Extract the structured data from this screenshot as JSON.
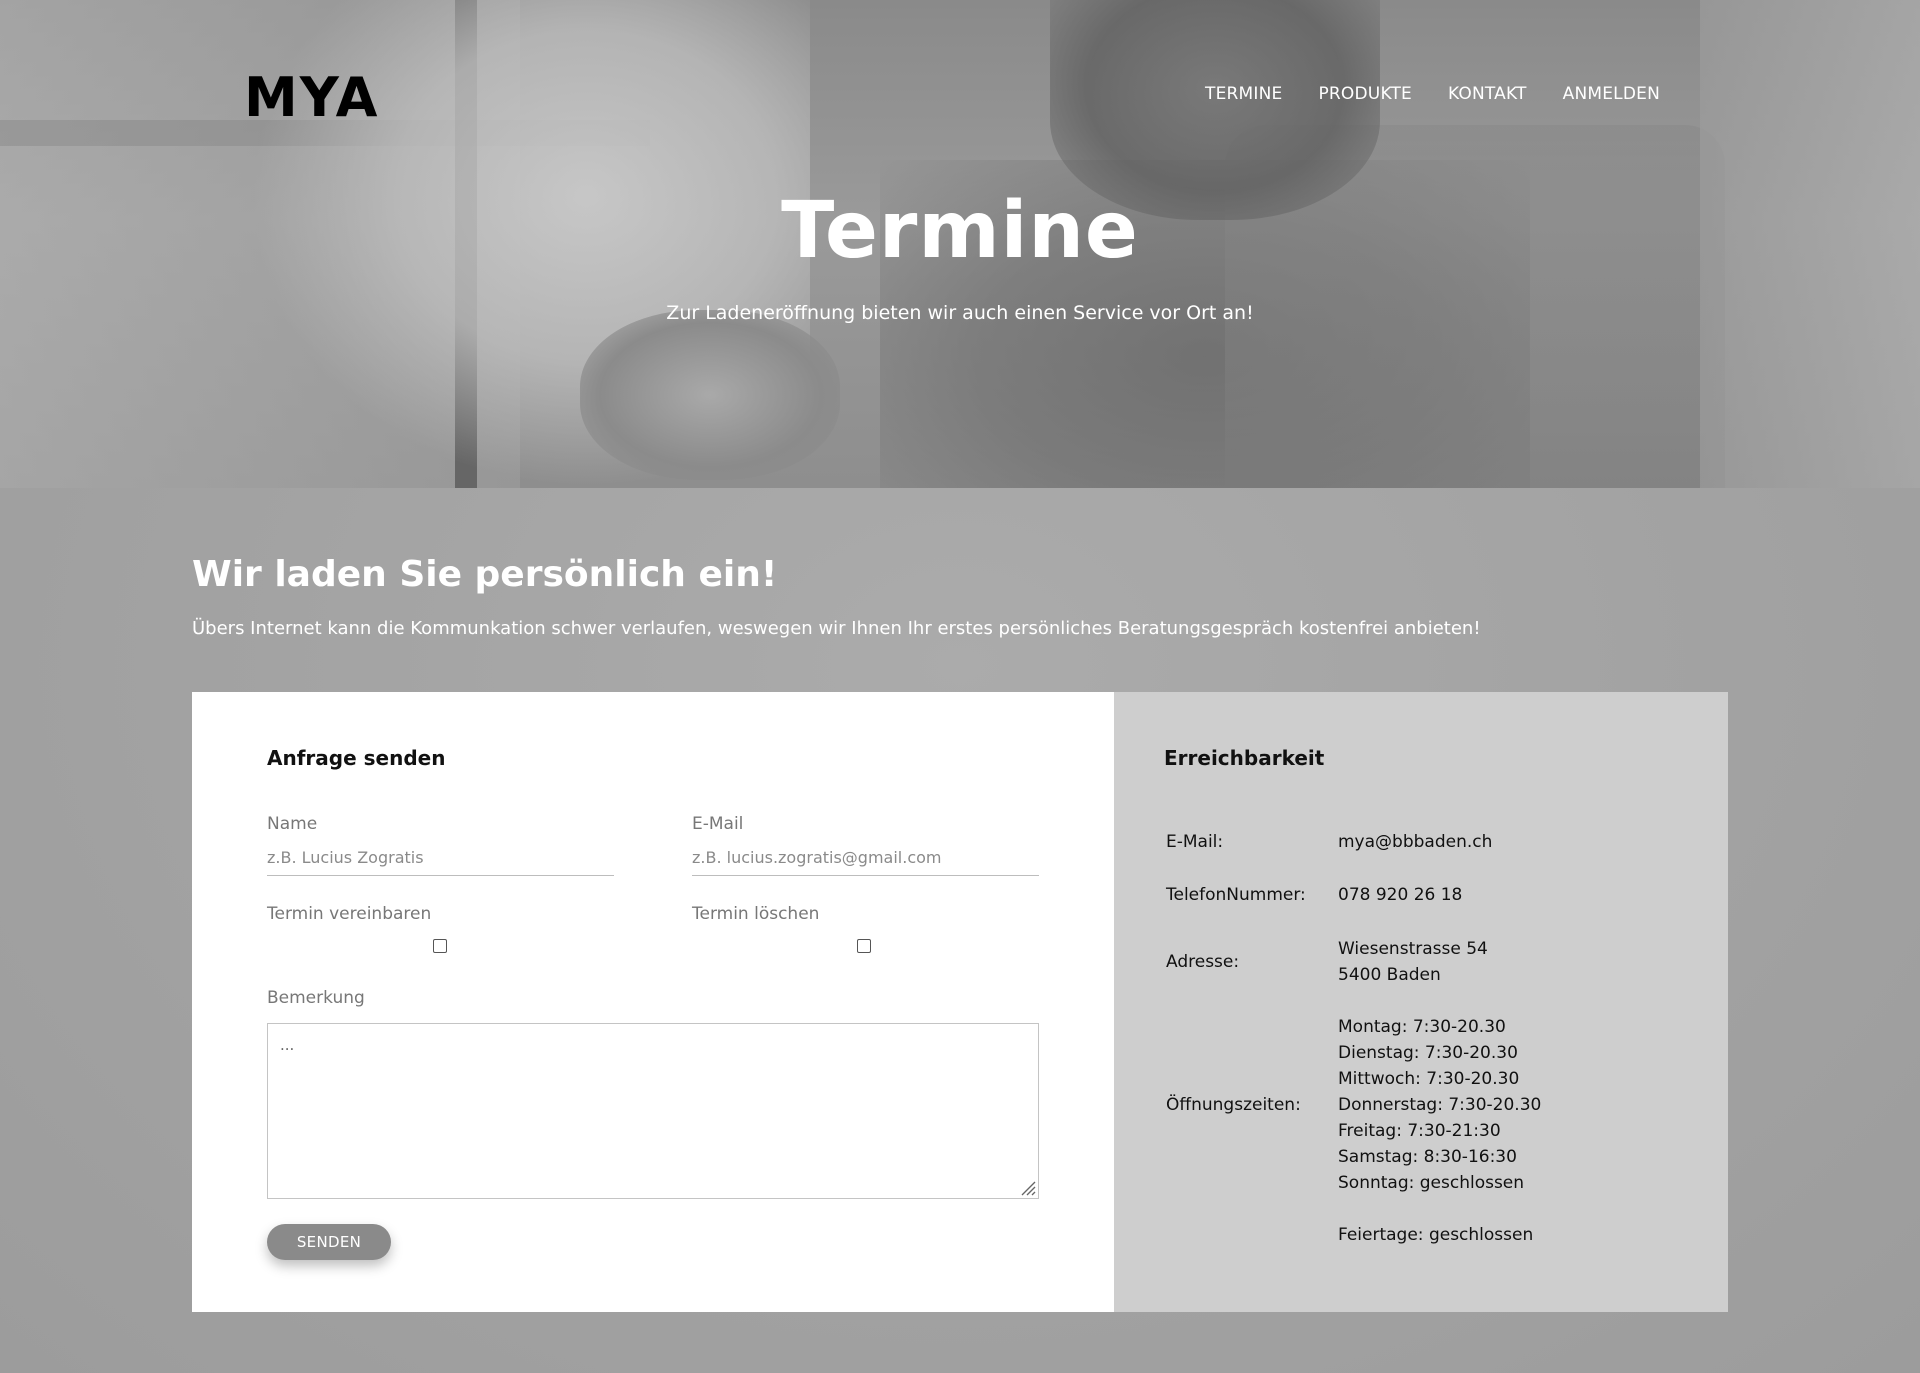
{
  "header": {
    "logo": "MYA",
    "nav": [
      "TERMINE",
      "PRODUKTE",
      "KONTAKT",
      "ANMELDEN"
    ],
    "title": "Termine",
    "subtitle": "Zur Ladeneröffnung bieten wir auch einen Service vor Ort an!"
  },
  "intro": {
    "headline": "Wir laden Sie persönlich ein!",
    "text": "Übers Internet kann die Kommunkation schwer verlaufen, weswegen wir Ihnen Ihr erstes persönliches Beratungsgespräch kostenfrei anbieten!"
  },
  "form": {
    "title": "Anfrage senden",
    "name_label": "Name",
    "name_placeholder": "z.B. Lucius Zogratis",
    "email_label": "E-Mail",
    "email_placeholder": "z.B. lucius.zogratis@gmail.com",
    "book_label": "Termin vereinbaren",
    "delete_label": "Termin löschen",
    "remark_label": "Bemerkung",
    "remark_placeholder": "...",
    "submit_label": "SENDEN"
  },
  "info": {
    "title": "Erreichbarkeit",
    "email_label": "E-Mail:",
    "email_value": "mya@bbbaden.ch",
    "phone_label": "TelefonNummer:",
    "phone_value": "078 920 26 18",
    "address_label": "Adresse:",
    "address_line1": "Wiesenstrasse 54",
    "address_line2": "5400 Baden",
    "hours_label": "Öffnungszeiten:",
    "hours": [
      "Montag: 7:30-20.30",
      "Dienstag: 7:30-20.30",
      "Mittwoch: 7:30-20.30",
      "Donnerstag: 7:30-20.30",
      "Freitag: 7:30-21:30",
      "Samstag: 8:30-16:30",
      "Sonntag: geschlossen"
    ],
    "holidays": "Feiertage: geschlossen"
  }
}
